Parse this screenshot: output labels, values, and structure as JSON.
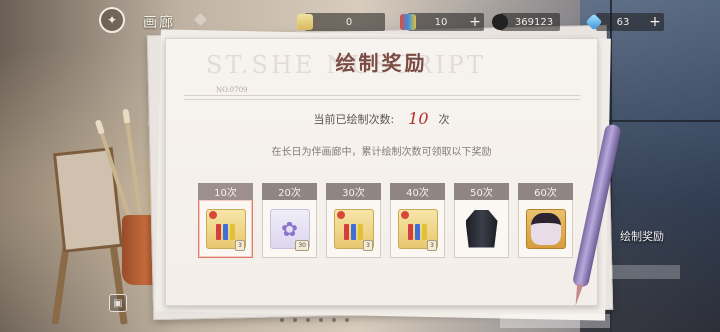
{
  "topbar": {
    "title": "画廊",
    "resources": [
      {
        "icon": "paint-set-icon",
        "value": "0",
        "plus": "+"
      },
      {
        "icon": "paint-tubes-icon",
        "value": "10",
        "plus": "+"
      },
      {
        "icon": "currency-icon",
        "value": "369123",
        "plus": ""
      },
      {
        "icon": "gem-icon",
        "value": "63",
        "plus": "+"
      }
    ]
  },
  "panel": {
    "watermark": "ST.SHE        NUSCRIPT",
    "title": "绘制奖励",
    "doc_no": "NO.0709",
    "count_label": "当前已绘制次数:",
    "count_value": "10",
    "count_unit": "次",
    "description": "在长日为伴画廊中，累计绘制次数可领取以下奖励",
    "rewards": [
      {
        "label": "10次",
        "icon": "paint-set-icon",
        "qty": "3"
      },
      {
        "label": "20次",
        "icon": "flower-fairy-icon",
        "qty": "30"
      },
      {
        "label": "30次",
        "icon": "paint-set-icon",
        "qty": "3"
      },
      {
        "label": "40次",
        "icon": "paint-set-icon",
        "qty": "3"
      },
      {
        "label": "50次",
        "icon": "coat-icon",
        "qty": ""
      },
      {
        "label": "60次",
        "icon": "portrait-icon",
        "qty": ""
      }
    ]
  },
  "side": {
    "label": "绘制奖励"
  },
  "colors": {
    "accent": "#b4302a",
    "title": "#7a4c44",
    "header_tab": "#8f8683",
    "current_border": "#e17b66"
  }
}
